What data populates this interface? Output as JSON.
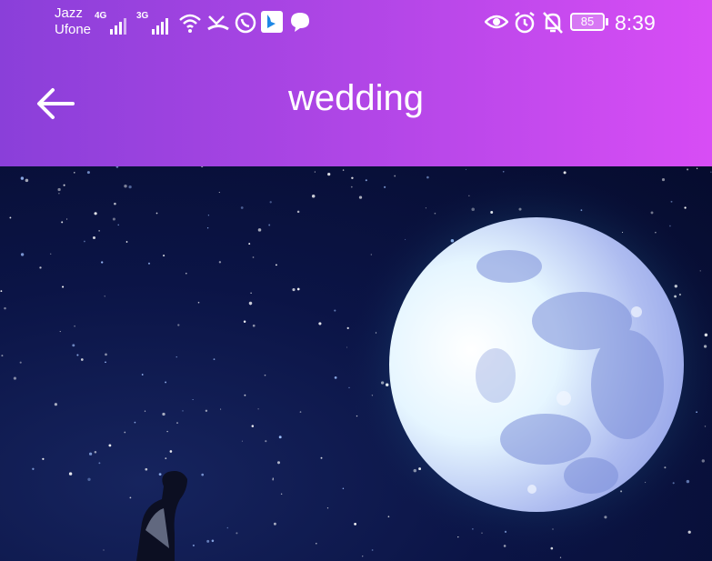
{
  "status_bar": {
    "carrier_1": "Jazz",
    "carrier_2": "Ufone",
    "network_1": "4G",
    "network_2": "3G",
    "battery": "85",
    "time": "8:39",
    "icons": [
      "wifi-icon",
      "missed-call-icon",
      "whatsapp-icon",
      "bing-icon",
      "chat-bubble-icon",
      "eye-icon",
      "alarm-icon",
      "bell-off-icon",
      "battery-icon"
    ]
  },
  "header": {
    "title": "wedding",
    "back_icon": "arrow-left-icon",
    "gradient_colors": [
      "#8a3fd9",
      "#d84df5"
    ]
  },
  "content": {
    "image": "night-sky-moon-photo",
    "colors": {
      "sky": "#0b1446",
      "moon": "#dbe6ff",
      "moon_glow": "#5ad8e6"
    }
  }
}
